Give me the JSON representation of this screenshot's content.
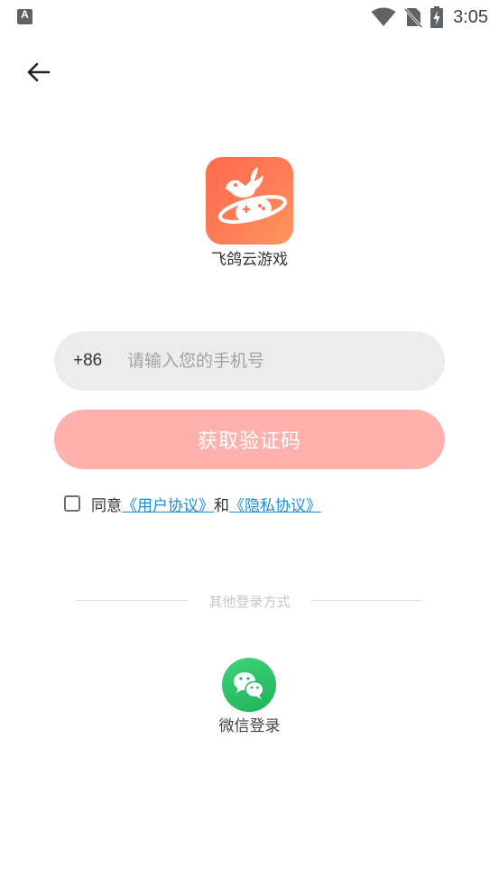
{
  "status_bar": {
    "time": "3:05",
    "left_icon": "app-notification-icon",
    "icons": [
      "wifi-icon",
      "no-sim-icon",
      "battery-charging-icon"
    ]
  },
  "nav": {
    "back_icon": "arrow-left-icon"
  },
  "app": {
    "name": "飞鸽云游戏",
    "logo_icon": "pigeon-gamepad-logo",
    "brand_color": "#ff7354"
  },
  "login_form": {
    "country_code": "+86",
    "phone_placeholder": "请输入您的手机号",
    "phone_value": "",
    "get_code_label": "获取验证码",
    "button_color": "#ffb1ae"
  },
  "agreement": {
    "checked": false,
    "prefix": "同意",
    "user_agreement": "《用户协议》",
    "conjunction": "和",
    "privacy_policy": "《隐私协议》",
    "link_color": "#1a8ed6"
  },
  "other_login": {
    "divider_text": "其他登录方式",
    "wechat_label": "微信登录",
    "wechat_icon": "wechat-icon",
    "wechat_color": "#2ac26a"
  }
}
